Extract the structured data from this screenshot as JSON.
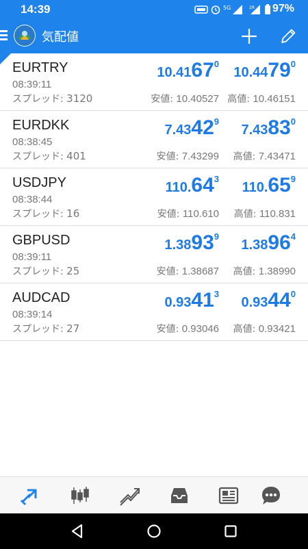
{
  "status": {
    "time": "14:39",
    "battery": "97%"
  },
  "appbar": {
    "title": "気配値"
  },
  "labels": {
    "spread": "スプレッド: ",
    "low": "安値: ",
    "high": "高値: "
  },
  "quotes": [
    {
      "symbol": "EURTRY",
      "time": "08:39:11",
      "spread": "3120",
      "bid": {
        "pre": "10.41",
        "big": "67",
        "pip": "0"
      },
      "ask": {
        "pre": "10.44",
        "big": "79",
        "pip": "0"
      },
      "low": "10.40527",
      "high": "10.46151"
    },
    {
      "symbol": "EURDKK",
      "time": "08:38:45",
      "spread": "401",
      "bid": {
        "pre": "7.43",
        "big": "42",
        "pip": "9"
      },
      "ask": {
        "pre": "7.43",
        "big": "83",
        "pip": "0"
      },
      "low": "7.43299",
      "high": "7.43471"
    },
    {
      "symbol": "USDJPY",
      "time": "08:38:44",
      "spread": "16",
      "bid": {
        "pre": "110.",
        "big": "64",
        "pip": "3"
      },
      "ask": {
        "pre": "110.",
        "big": "65",
        "pip": "9"
      },
      "low": "110.610",
      "high": "110.831"
    },
    {
      "symbol": "GBPUSD",
      "time": "08:39:11",
      "spread": "25",
      "bid": {
        "pre": "1.38",
        "big": "93",
        "pip": "9"
      },
      "ask": {
        "pre": "1.38",
        "big": "96",
        "pip": "4"
      },
      "low": "1.38687",
      "high": "1.38990"
    },
    {
      "symbol": "AUDCAD",
      "time": "08:39:14",
      "spread": "27",
      "bid": {
        "pre": "0.93",
        "big": "41",
        "pip": "3"
      },
      "ask": {
        "pre": "0.93",
        "big": "44",
        "pip": "0"
      },
      "low": "0.93046",
      "high": "0.93421"
    }
  ],
  "nav": {
    "items": [
      "quotes-icon",
      "chart-icon",
      "trade-icon",
      "history-icon",
      "news-icon",
      "chat-icon"
    ],
    "active": "quotes-icon"
  },
  "colors": {
    "accent": "#1f83ec",
    "price": "#1e7be6",
    "icon": "#555555"
  }
}
